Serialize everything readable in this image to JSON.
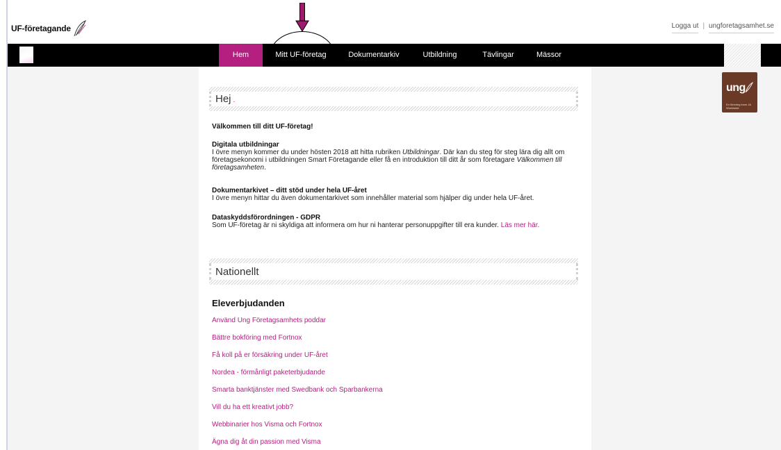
{
  "brand": {
    "logo_text": "UF-företagande"
  },
  "header": {
    "logout": "Logga ut",
    "site_link": "ungforetagsamhet.se"
  },
  "nav": {
    "items": [
      {
        "label": "Hem"
      },
      {
        "label": "Mitt UF-företag"
      },
      {
        "label": "Dokumentarkiv"
      },
      {
        "label": "Utbildning"
      },
      {
        "label": "Tävlingar"
      },
      {
        "label": "Mässor"
      }
    ],
    "active_color": "#b51f7f"
  },
  "partner_logo": {
    "text": "ung",
    "subtext": "En förening inom JA Worldwide"
  },
  "greeting": {
    "title": "Hej",
    "suffix": "."
  },
  "welcome": "Välkommen till ditt UF-företag!",
  "sections": [
    {
      "heading": "Digitala utbildningar",
      "body_1": "I övre menyn kommer du under hösten 2018 att hitta rubriken ",
      "emph_1": "Utbildningar",
      "body_2": ". Där kan du steg för steg lära dig allt om företagsekonomi i utbildningen Smart Företagande eller få en introduktion till ditt år som företagare ",
      "emph_2": "Välkommen till företagsamheten",
      "body_3": "."
    },
    {
      "heading": "Dokumentarkivet – ditt stöd under hela UF-året",
      "body_1": "I övre menyn hittar du även dokumentarkivet som innehåller material som hjälper dig under hela UF-året."
    },
    {
      "heading": "Dataskyddsförordningen - GDPR",
      "body_1": "Som UF-företag är ni skyldiga att informera om hur ni hanterar personuppgifter till era kunder. ",
      "link": "Läs mer här."
    }
  ],
  "national": {
    "title": "Nationellt",
    "subheading": "Eleverbjudanden",
    "offers": [
      "Använd Ung Företagsamhets poddar",
      "Bättre bokföring med Fortnox",
      "Få koll på er försäkring under UF-året",
      "Nordea - förmånligt paketerbjudande",
      "Smarta banktjänster med Swedbank och Sparbankerna",
      "Vill du ha ett kreativt jobb?",
      "Webbinarier hos Visma och Fortnox",
      "Ägna dig åt din passion med Visma"
    ]
  },
  "annotations": {
    "arrow_color": "#a0196e",
    "ellipse_icon": "circle-annotation"
  }
}
